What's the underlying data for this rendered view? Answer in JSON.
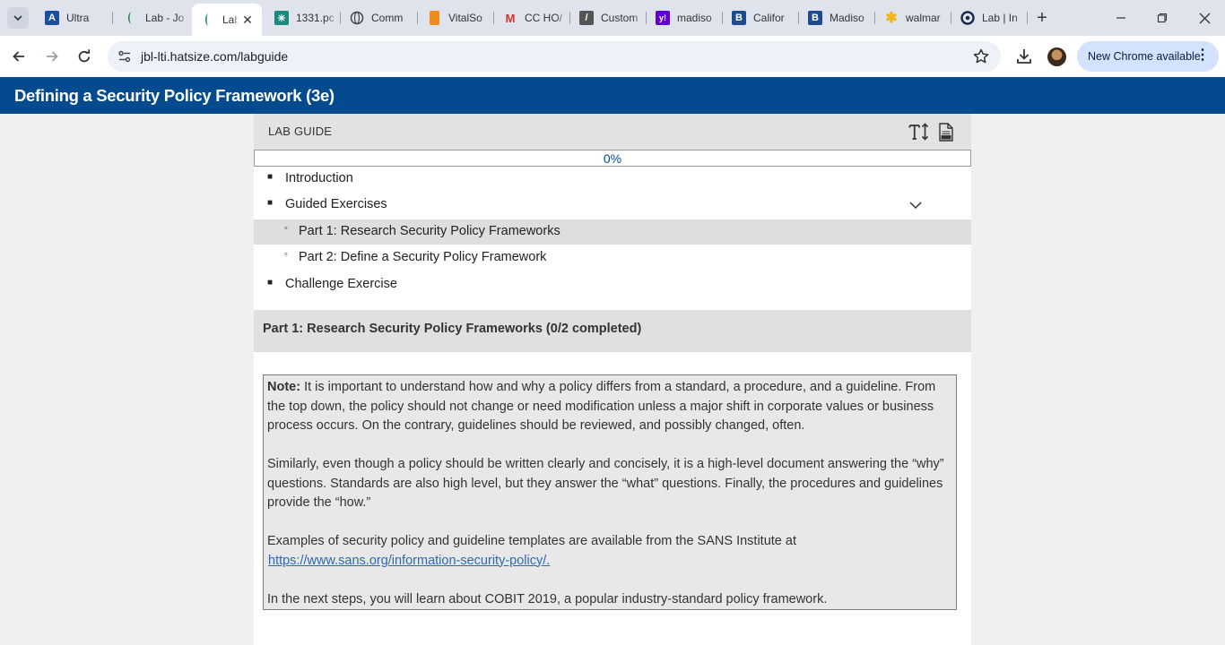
{
  "browser": {
    "tabs": [
      {
        "title": "Ultra",
        "favicon": "A",
        "favicon_color": "#1b4fa0",
        "active": false
      },
      {
        "title": "Lab - Jo",
        "favicon": "",
        "favicon_color": "#0a8a3a",
        "active": false
      },
      {
        "title": "Lab",
        "favicon": "",
        "favicon_color": "#0a8a3a",
        "active": true
      },
      {
        "title": "1331.pc",
        "favicon": "✳",
        "favicon_color": "#19897e",
        "active": false
      },
      {
        "title": "Comm",
        "favicon": "◍",
        "favicon_color": "#444444",
        "active": false
      },
      {
        "title": "VitalSo",
        "favicon": "▮",
        "favicon_color": "#f08a1c",
        "active": false
      },
      {
        "title": "CC HO/",
        "favicon": "M",
        "favicon_color": "#d93025",
        "active": false
      },
      {
        "title": "Custom",
        "favicon": "/",
        "favicon_color": "#555555",
        "active": false
      },
      {
        "title": "madiso",
        "favicon": "y!",
        "favicon_color": "#6001d2",
        "active": false
      },
      {
        "title": "Califor",
        "favicon": "B",
        "favicon_color": "#1d4b8f",
        "active": false
      },
      {
        "title": "Madiso",
        "favicon": "B",
        "favicon_color": "#1d4b8f",
        "active": false
      },
      {
        "title": "walmar",
        "favicon": "✱",
        "favicon_color": "#f2b418",
        "active": false
      },
      {
        "title": "Lab | In",
        "favicon": "◉",
        "favicon_color": "#1b2a4a",
        "active": false
      }
    ],
    "url": "jbl-lti.hatsize.com/labguide",
    "update_label": "New Chrome available",
    "accent_color": "#d3e3fd"
  },
  "app": {
    "title": "Defining a Security Policy Framework (3e)",
    "header_color": "#034a8e"
  },
  "lab_guide": {
    "label": "LAB GUIDE",
    "progress": {
      "value": 0,
      "text": "0%"
    },
    "toc": [
      {
        "label": "Introduction",
        "level": 1
      },
      {
        "label": "Guided Exercises",
        "level": 1,
        "expandable": true
      },
      {
        "label": "Part 1: Research Security Policy Frameworks",
        "level": 2,
        "selected": true
      },
      {
        "label": "Part 2: Define a Security Policy Framework",
        "level": 2
      },
      {
        "label": "Challenge Exercise",
        "level": 1
      }
    ],
    "section_title": "Part 1: Research Security Policy Frameworks (0/2 completed)",
    "note": {
      "label": "Note:",
      "p1": " It is important to understand how and why a policy differs from a standard, a procedure, and a guideline. From the top down, the policy should not change or need modification unless a major shift in corporate values or business process occurs. On the contrary, guidelines should be reviewed, and possibly changed, often.",
      "p2": "Similarly, even though a policy should be written clearly and concisely, it is a high-level document answering the “why” questions. Standards are also high level, but they answer the “what” questions. Finally, the procedures and guidelines provide the “how.”",
      "p3": "Examples of security policy and guideline templates are available from the SANS Institute at",
      "link": "https://www.sans.org/information-security-policy/.",
      "p4": "In the next steps, you will learn about COBIT 2019, a popular industry-standard policy framework."
    }
  }
}
